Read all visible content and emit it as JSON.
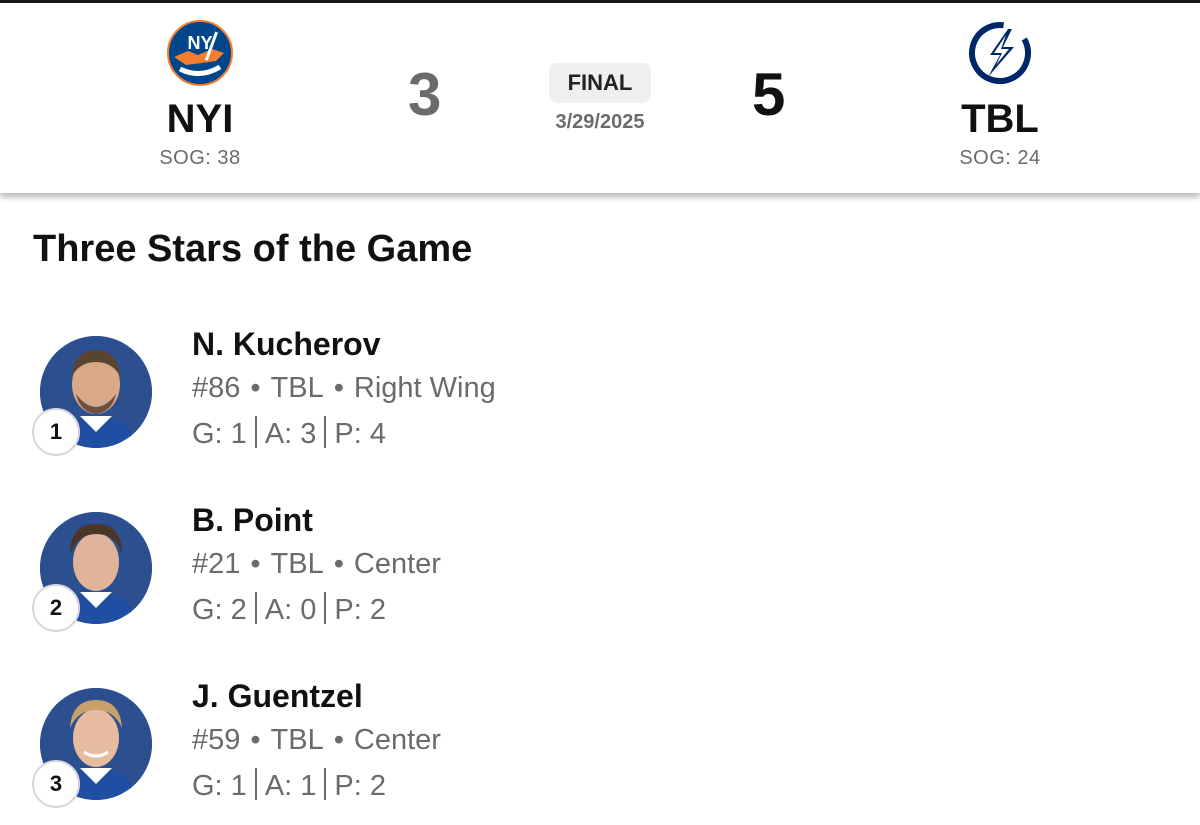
{
  "game": {
    "home": {
      "abbr": "NYI",
      "sog": "SOG: 38",
      "score": "3",
      "logo": "islanders-logo",
      "color": "#f47d30"
    },
    "away": {
      "abbr": "TBL",
      "sog": "SOG: 24",
      "score": "5",
      "logo": "lightning-logo",
      "color": "#002868"
    },
    "status": "FINAL",
    "date": "3/29/2025"
  },
  "section_title": "Three Stars of the Game",
  "stars": [
    {
      "rank": "1",
      "name": "N. Kucherov",
      "number": "#86",
      "team": "TBL",
      "position": "Right Wing",
      "goals": "G: 1",
      "assists": "A: 3",
      "points": "P: 4"
    },
    {
      "rank": "2",
      "name": "B. Point",
      "number": "#21",
      "team": "TBL",
      "position": "Center",
      "goals": "G: 2",
      "assists": "A: 0",
      "points": "P: 2"
    },
    {
      "rank": "3",
      "name": "J. Guentzel",
      "number": "#59",
      "team": "TBL",
      "position": "Center",
      "goals": "G: 1",
      "assists": "A: 1",
      "points": "P: 2"
    }
  ],
  "colors": {
    "muted_text": "#6b6b6b",
    "pill_bg": "#efefef",
    "jersey_blue": "#1f4fa3"
  }
}
